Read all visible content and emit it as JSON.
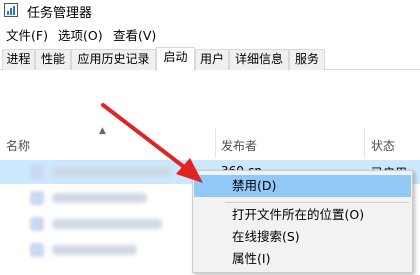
{
  "window": {
    "title": "任务管理器"
  },
  "menu": {
    "file": "文件(F)",
    "options": "选项(O)",
    "view": "查看(V)"
  },
  "tabs": [
    "进程",
    "性能",
    "应用历史记录",
    "启动",
    "用户",
    "详细信息",
    "服务"
  ],
  "active_tab": "启动",
  "columns": {
    "name": "名称",
    "publisher": "发布者",
    "status": "状态"
  },
  "rows": [
    {
      "publisher": "360.cn",
      "status": "已启用",
      "selected": true
    }
  ],
  "context_menu": {
    "items": [
      {
        "label": "禁用(D)",
        "highlighted": true
      },
      {
        "label": "打开文件所在的位置(O)"
      },
      {
        "label": "在线搜索(S)"
      },
      {
        "label": "属性(I)"
      }
    ]
  },
  "colors": {
    "selected_row": "#cce8ff",
    "highlight_item": "#91c9f7",
    "arrow": "#e02424"
  },
  "icons": {
    "app": "task-manager-icon",
    "sort": "chevron-up-icon"
  }
}
